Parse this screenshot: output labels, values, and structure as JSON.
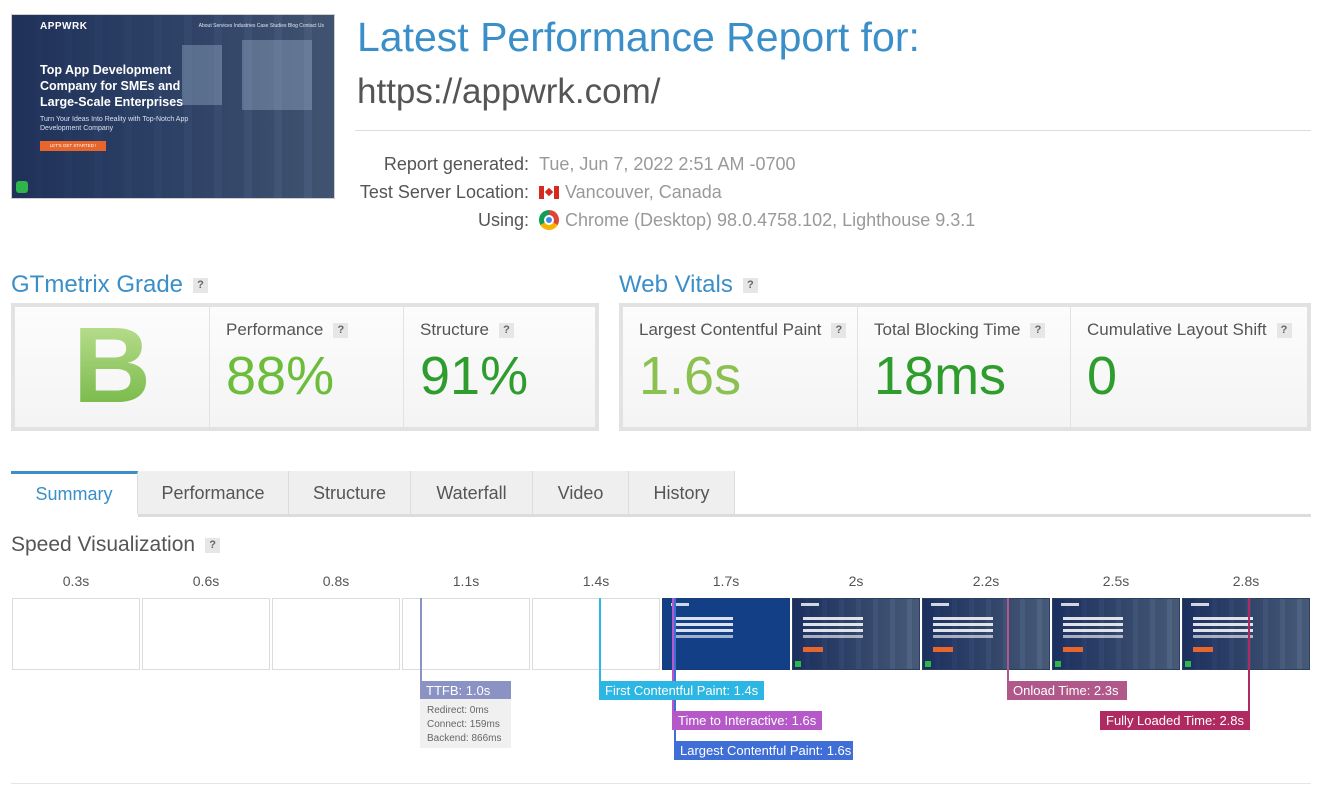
{
  "thumbnail": {
    "logo": "APPWRK",
    "nav": "About   Services   Industries   Case Studies   Blog   Contact Us",
    "headline": "Top App Development Company for SMEs and Large-Scale Enterprises",
    "subtext": "Turn Your Ideas Into Reality with Top-Notch App Development Company",
    "cta": "LET'S GET STARTED !"
  },
  "header": {
    "title": "Latest Performance Report for:",
    "url": "https://appwrk.com/"
  },
  "meta": {
    "generated_label": "Report generated:",
    "generated_value": "Tue, Jun 7, 2022 2:51 AM -0700",
    "location_label": "Test Server Location:",
    "location_value": "Vancouver, Canada",
    "using_label": "Using:",
    "using_value": "Chrome (Desktop) 98.0.4758.102, Lighthouse 9.3.1"
  },
  "grade": {
    "title": "GTmetrix Grade",
    "letter": "B",
    "performance_label": "Performance",
    "performance_value": "88%",
    "structure_label": "Structure",
    "structure_value": "91%"
  },
  "vitals": {
    "title": "Web Vitals",
    "lcp_label": "Largest Contentful Paint",
    "lcp_value": "1.6s",
    "tbt_label": "Total Blocking Time",
    "tbt_value": "18ms",
    "cls_label": "Cumulative Layout Shift",
    "cls_value": "0"
  },
  "help_glyph": "?",
  "tabs": [
    {
      "label": "Summary",
      "active": true
    },
    {
      "label": "Performance",
      "active": false
    },
    {
      "label": "Structure",
      "active": false
    },
    {
      "label": "Waterfall",
      "active": false
    },
    {
      "label": "Video",
      "active": false
    },
    {
      "label": "History",
      "active": false
    }
  ],
  "speed": {
    "title": "Speed Visualization",
    "ticks": [
      "0.3s",
      "0.6s",
      "0.8s",
      "1.1s",
      "1.4s",
      "1.7s",
      "2s",
      "2.2s",
      "2.5s",
      "2.8s"
    ],
    "markers": {
      "ttfb": "TTFB: 1.0s",
      "redirect": "Redirect: 0ms",
      "connect": "Connect: 159ms",
      "backend": "Backend: 866ms",
      "fcp": "First Contentful Paint: 1.4s",
      "tti": "Time to Interactive: 1.6s",
      "lcp": "Largest Contentful Paint: 1.6s",
      "onload": "Onload Time: 2.3s",
      "fully": "Fully Loaded Time: 2.8s"
    }
  },
  "colors": {
    "accent": "#3a8fc9",
    "grade_green": "#8ec455",
    "perf_green": "#6cbd3c",
    "vital_green": "#2e9d2e",
    "ttfb": "#8b93c5",
    "fcp": "#2bb6e3",
    "tti": "#b559c9",
    "lcp": "#3f6fd6",
    "onload": "#b0588a",
    "fully": "#b02a62"
  }
}
